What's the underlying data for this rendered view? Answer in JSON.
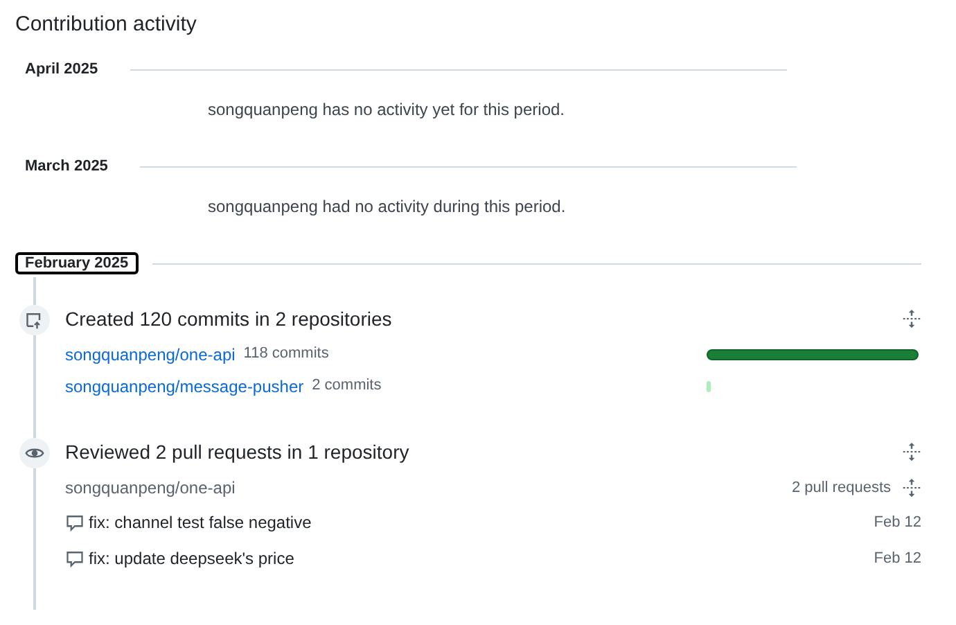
{
  "title": "Contribution activity",
  "months": [
    {
      "label": "April 2025",
      "focused": false,
      "empty_text": "songquanpeng has no activity yet for this period."
    },
    {
      "label": "March 2025",
      "focused": false,
      "empty_text": "songquanpeng had no activity during this period."
    },
    {
      "label": "February 2025",
      "focused": true,
      "events": [
        {
          "kind": "commits",
          "title": "Created 120 commits in 2 repositories",
          "repos": [
            {
              "name": "songquanpeng/one-api",
              "count": "118 commits"
            },
            {
              "name": "songquanpeng/message-pusher",
              "count": "2 commits"
            }
          ]
        },
        {
          "kind": "reviews",
          "title": "Reviewed 2 pull requests in 1 repository",
          "repo": "songquanpeng/one-api",
          "count": "2 pull requests",
          "items": [
            {
              "title": "fix: channel test false negative",
              "date": "Feb 12"
            },
            {
              "title": "fix: update deepseek's price",
              "date": "Feb 12"
            }
          ]
        }
      ]
    }
  ]
}
